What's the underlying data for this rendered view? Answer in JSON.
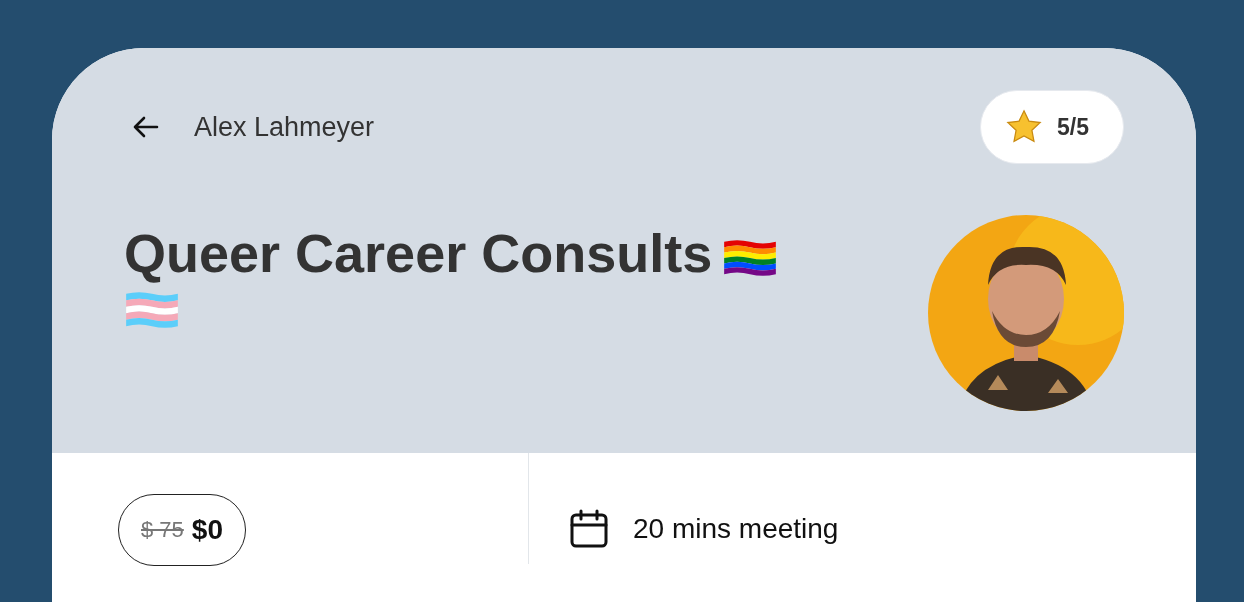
{
  "header": {
    "back_label": "Alex Lahmeyer",
    "rating": "5/5"
  },
  "title": "Queer Career Consults",
  "flags": [
    {
      "kind": "rainbow"
    },
    {
      "kind": "trans"
    }
  ],
  "price": {
    "old": "$ 75",
    "current": "$0"
  },
  "meeting": "20 mins meeting"
}
